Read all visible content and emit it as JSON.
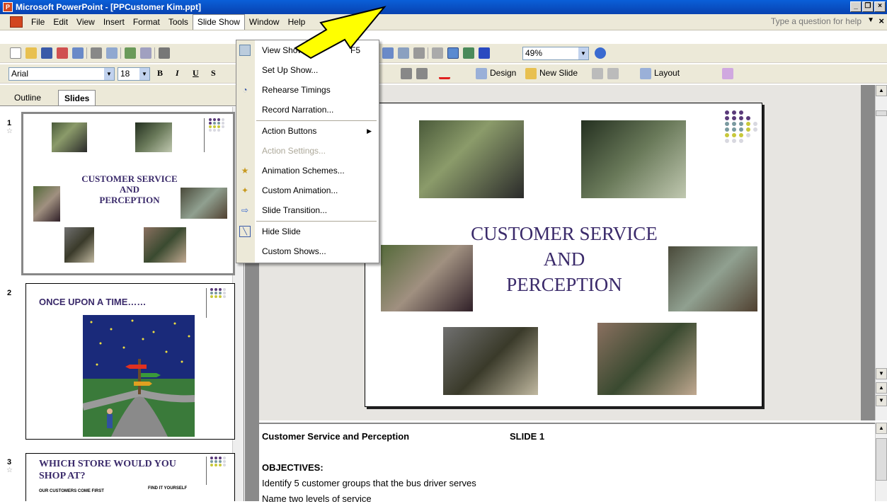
{
  "window": {
    "title": "Microsoft PowerPoint - [PPCustomer  Kim.ppt]"
  },
  "menubar": {
    "items": [
      "File",
      "Edit",
      "View",
      "Insert",
      "Format",
      "Tools",
      "Slide Show",
      "Window",
      "Help"
    ],
    "active": "Slide Show",
    "help_placeholder": "Type a question for help"
  },
  "toolbar": {
    "zoom": "49%",
    "font_name": "Arial",
    "font_size": "18",
    "bold": "B",
    "italic": "I",
    "underline": "U",
    "shadow": "S",
    "design_label": "Design",
    "new_slide_label": "New Slide",
    "layout_label": "Layout"
  },
  "tabs": {
    "outline": "Outline",
    "slides": "Slides"
  },
  "slide_show_menu": {
    "items": [
      {
        "label": "View Show",
        "shortcut": "F5",
        "icon": "projector-icon"
      },
      {
        "label": "Set Up Show..."
      },
      {
        "label": "Rehearse Timings",
        "icon": "stopwatch-icon"
      },
      {
        "label": "Record Narration..."
      },
      {
        "label": "Action Buttons",
        "submenu": true
      },
      {
        "label": "Action Settings...",
        "disabled": true
      },
      {
        "label": "Animation Schemes...",
        "icon": "animation-schemes-icon"
      },
      {
        "label": "Custom Animation...",
        "icon": "custom-animation-icon"
      },
      {
        "label": "Slide Transition...",
        "icon": "slide-transition-icon"
      },
      {
        "label": "Hide Slide",
        "icon": "hide-slide-icon"
      },
      {
        "label": "Custom Shows..."
      }
    ]
  },
  "slides": [
    {
      "number": "1",
      "title_line1": "CUSTOMER SERVICE",
      "title_line2": "AND",
      "title_line3": "PERCEPTION"
    },
    {
      "number": "2",
      "title": "ONCE UPON A TIME……"
    },
    {
      "number": "3",
      "title_line1": "WHICH STORE WOULD YOU",
      "title_line2": "SHOP AT?",
      "caption_left": "OUR CUSTOMERS COME FIRST",
      "caption_right": "FIND IT YOURSELF"
    }
  ],
  "main_slide": {
    "title_line1": "CUSTOMER SERVICE",
    "title_line2": "AND",
    "title_line3": "PERCEPTION"
  },
  "notes": {
    "heading": "Customer Service and Perception",
    "slide_label": "SLIDE 1",
    "objectives_heading": "OBJECTIVES:",
    "line1": "Identify 5 customer groups that the bus driver serves",
    "line2": "Name two levels of service"
  },
  "colors": {
    "title_purple": "#3a2a6a",
    "dot_purple": "#5a3a7a",
    "dot_teal": "#7a9aa0",
    "dot_yellow": "#c8c83a",
    "dot_gray": "#d8d8e0"
  }
}
